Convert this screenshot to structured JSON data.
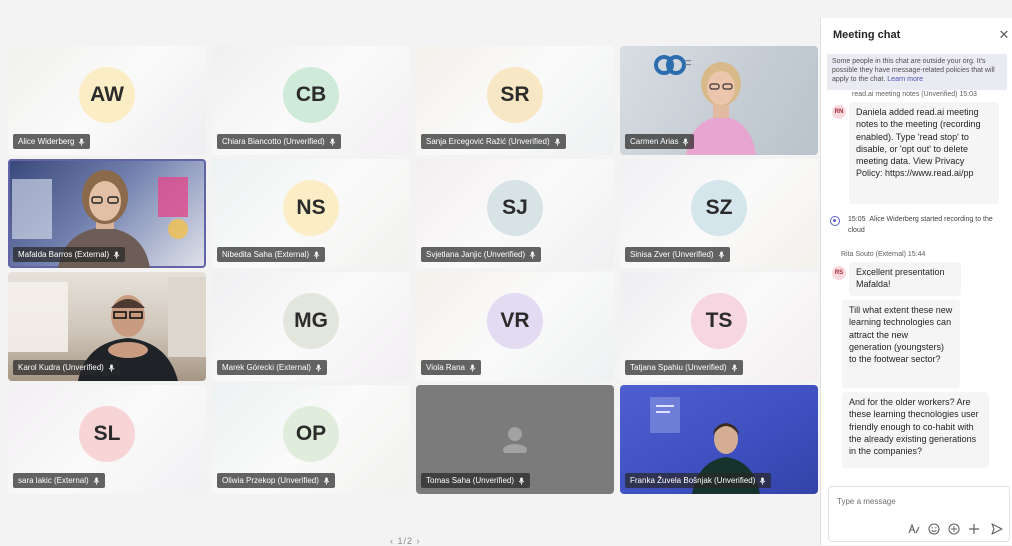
{
  "grid": {
    "tiles": [
      {
        "initials": "AW",
        "name": "Alice Widerberg",
        "avatar_color": "#fbeec6"
      },
      {
        "initials": "CB",
        "name": "Chiara Biancotto (Unverified)",
        "avatar_color": "#cfead8"
      },
      {
        "initials": "SR",
        "name": "Sanja Ercegović Ražić (Unverified)",
        "avatar_color": "#f8e7c5"
      },
      {
        "initials": "",
        "name": "Carmen Arias",
        "video": true
      },
      {
        "initials": "",
        "name": "Mafalda Barros (External)",
        "video": true,
        "speaking": true
      },
      {
        "initials": "NS",
        "name": "Nibedita Saha (External)",
        "avatar_color": "#fbeec6"
      },
      {
        "initials": "SJ",
        "name": "Svjetlana Janjic (Unverified)",
        "avatar_color": "#d7e3e5"
      },
      {
        "initials": "SZ",
        "name": "Sinisa Zver (Unverified)",
        "avatar_color": "#d4e6ec"
      },
      {
        "initials": "",
        "name": "Karol Kudra (Unverified)",
        "video": true
      },
      {
        "initials": "MG",
        "name": "Marek Górecki (External)",
        "avatar_color": "#e3e6dc"
      },
      {
        "initials": "VR",
        "name": "Viola Rana",
        "avatar_color": "#e2dbf2"
      },
      {
        "initials": "TS",
        "name": "Tatjana Spahiu (Unverified)",
        "avatar_color": "#f6d6e0"
      },
      {
        "initials": "SL",
        "name": "sara lakic (External)",
        "avatar_color": "#f7d5d7"
      },
      {
        "initials": "OP",
        "name": "Oliwia Przekop (Unverified)",
        "avatar_color": "#e1eddc"
      },
      {
        "initials": "",
        "name": "Tomas Saha (Unverified)",
        "video": true
      },
      {
        "initials": "",
        "name": "Franka Žuvela Bošnjak (Unverified)",
        "video": true
      }
    ]
  },
  "chat": {
    "title": "Meeting chat",
    "close_icon": "close-icon",
    "notice": "Some people in this chat are outside your org. It's possible they have message-related policies that will apply to the chat.",
    "notice_link": "Learn more",
    "messages": {
      "m1_meta": "read.ai meeting notes (Unverified)  15:03",
      "m1_initials": "RN",
      "m1_text": "Daniela added read.ai meeting notes to the meeting (recording enabled). Type 'read stop' to disable, or 'opt out' to delete meeting data. View Privacy Policy: https://www.read.ai/pp",
      "sys_time": "15:05",
      "sys_text": "Alice Widerberg started recording to the cloud",
      "m2_meta": "Rita Souto (External)  15:44",
      "m2_initials": "RS",
      "m2_text1": "Excellent presentation Mafalda!",
      "m2_text2": "Till what extent these new learning technologies can attract the new generation (youngsters) to the footwear sector?",
      "m2_text3": "And for the older workers? Are these learning thecnologies user friendly enough to co-habit with the already existing generations in the companies?"
    },
    "composer": {
      "placeholder": "Type a message"
    }
  },
  "pager": "‹ 1/2 ›"
}
